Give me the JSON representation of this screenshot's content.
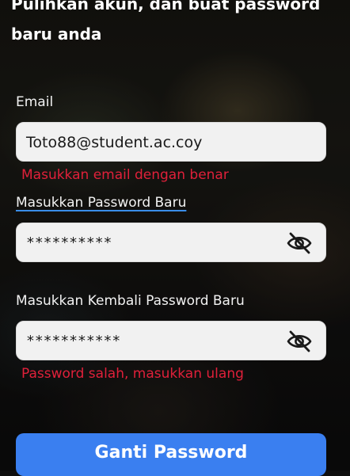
{
  "header": {
    "line1": "Pulihkan akun, dan buat password",
    "line2": "baru anda"
  },
  "email": {
    "label": "Email",
    "value": "Toto88@student.ac.coy",
    "error": "Masukkan email dengan benar"
  },
  "new_password": {
    "label": "Masukkan Password Baru",
    "value": "**********",
    "visibility_icon": "eye-off-icon"
  },
  "confirm_password": {
    "label": "Masukkan Kembali Password Baru",
    "value": "***********",
    "visibility_icon": "eye-off-icon",
    "error": "Password salah, masukkan ulang"
  },
  "submit": {
    "label": "Ganti Password"
  },
  "colors": {
    "primary": "#3a7ff0",
    "error": "#e0203a",
    "field_bg": "#f1f1f1",
    "link_underline": "#3a8de8"
  }
}
